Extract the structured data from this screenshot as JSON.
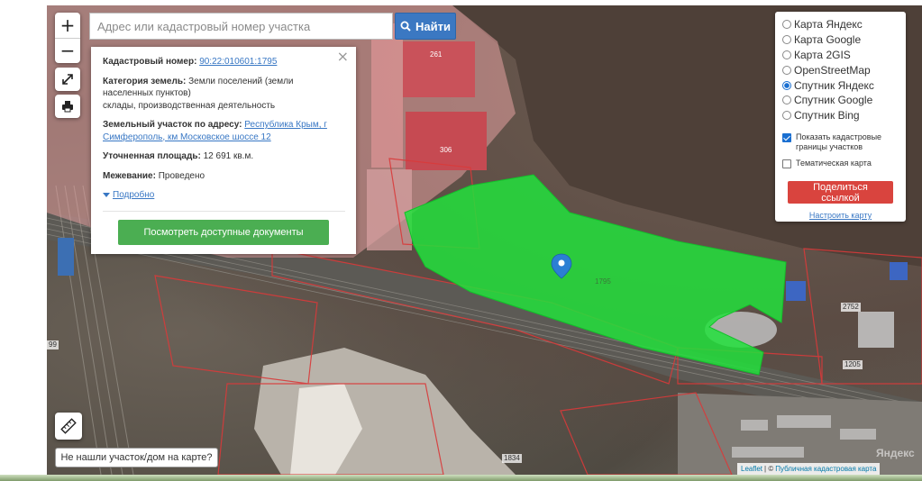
{
  "search": {
    "placeholder": "Адрес или кадастровый номер участка",
    "button_label": "Найти"
  },
  "zoom": {
    "in_label": "+",
    "out_label": "−"
  },
  "info_panel": {
    "cadastral_label": "Кадастровый номер:",
    "cadastral_value": "90:22:010601:1795",
    "land_category_label": "Категория земель:",
    "land_category_value": "Земли поселений (земли населенных пунктов)",
    "usage_value": "склады, производственная деятельность",
    "address_label": "Земельный участок по адресу:",
    "address_value": "Республика Крым, г Симферополь, км Московское шоссе 12",
    "area_label": "Уточненная площадь:",
    "area_value": "12 691 кв.м.",
    "survey_label": "Межевание:",
    "survey_value": "Проведено",
    "more_label": "Подробно",
    "docs_button": "Посмотреть доступные документы",
    "close_glyph": "×"
  },
  "layers": {
    "options": [
      {
        "label": "Карта Яндекс",
        "selected": false
      },
      {
        "label": "Карта Google",
        "selected": false
      },
      {
        "label": "Карта 2GIS",
        "selected": false
      },
      {
        "label": "OpenStreetMap",
        "selected": false
      },
      {
        "label": "Спутник Яндекс",
        "selected": true
      },
      {
        "label": "Спутник Google",
        "selected": false
      },
      {
        "label": "Спутник Bing",
        "selected": false
      }
    ],
    "show_cadastral_label": "Показать кадастровые границы участков",
    "show_cadastral_checked": true,
    "thematic_label": "Тематическая карта",
    "thematic_checked": false,
    "share_button": "Поделиться ссылкой",
    "setup_link": "Настроить карту"
  },
  "map_labels": {
    "parcel_number": "1795",
    "building_261": "261",
    "building_306": "306",
    "lot_2752": "2752",
    "lot_1205": "1205",
    "lot_1834": "1834",
    "edge_99": "99"
  },
  "not_found_label": "Не нашли участок/дом на карте?",
  "attribution": {
    "leaflet": "Leaflet",
    "separator": " | © ",
    "pkk": "Публичная кадастровая карта"
  },
  "yandex_watermark": "Яндекс",
  "colors": {
    "parcel_fill": "#22e03c",
    "search_blue": "#3b78c2",
    "docs_green": "#4bae52",
    "share_red": "#d9443e",
    "cadastral_border": "#d93a3a",
    "marker_blue": "#2b7fd4"
  }
}
